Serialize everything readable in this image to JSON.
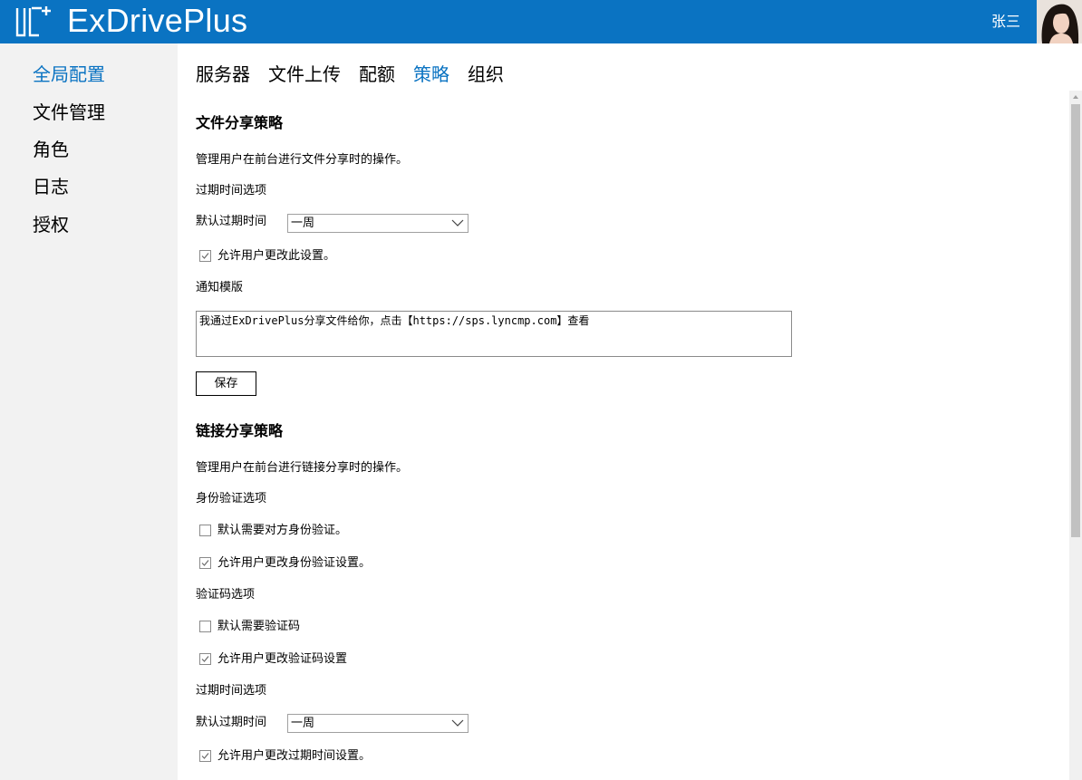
{
  "header": {
    "app_title": "ExDrivePlus",
    "user_name": "张三",
    "logo_text": "UC+",
    "colors": {
      "brand": "#0a73c2",
      "active_text": "#0a73c2"
    }
  },
  "sidebar": {
    "items": [
      {
        "label": "全局配置",
        "active": true
      },
      {
        "label": "文件管理",
        "active": false
      },
      {
        "label": "角色",
        "active": false
      },
      {
        "label": "日志",
        "active": false
      },
      {
        "label": "授权",
        "active": false
      }
    ]
  },
  "tabs": [
    {
      "label": "服务器",
      "active": false
    },
    {
      "label": "文件上传",
      "active": false
    },
    {
      "label": "配额",
      "active": false
    },
    {
      "label": "策略",
      "active": true
    },
    {
      "label": "组织",
      "active": false
    }
  ],
  "file_share": {
    "title": "文件分享策略",
    "description": "管理用户在前台进行文件分享时的操作。",
    "expire_section_label": "过期时间选项",
    "default_expire_label": "默认过期时间",
    "default_expire_value": "一周",
    "allow_change_label": "允许用户更改此设置。",
    "allow_change_checked": true,
    "template_label": "通知模版",
    "template_value": "我通过ExDrivePlus分享文件给你，点击【https://sps.lyncmp.com】查看",
    "save_label": "保存"
  },
  "link_share": {
    "title": "链接分享策略",
    "description": "管理用户在前台进行链接分享时的操作。",
    "auth_section_label": "身份验证选项",
    "require_auth_label": "默认需要对方身份验证。",
    "require_auth_checked": false,
    "allow_auth_change_label": "允许用户更改身份验证设置。",
    "allow_auth_change_checked": true,
    "captcha_section_label": "验证码选项",
    "require_captcha_label": "默认需要验证码",
    "require_captcha_checked": false,
    "allow_captcha_change_label": "允许用户更改验证码设置",
    "allow_captcha_change_checked": true,
    "expire_section_label": "过期时间选项",
    "default_expire_label": "默认过期时间",
    "default_expire_value": "一周",
    "allow_expire_change_label": "允许用户更改过期时间设置。",
    "allow_expire_change_checked": true
  }
}
